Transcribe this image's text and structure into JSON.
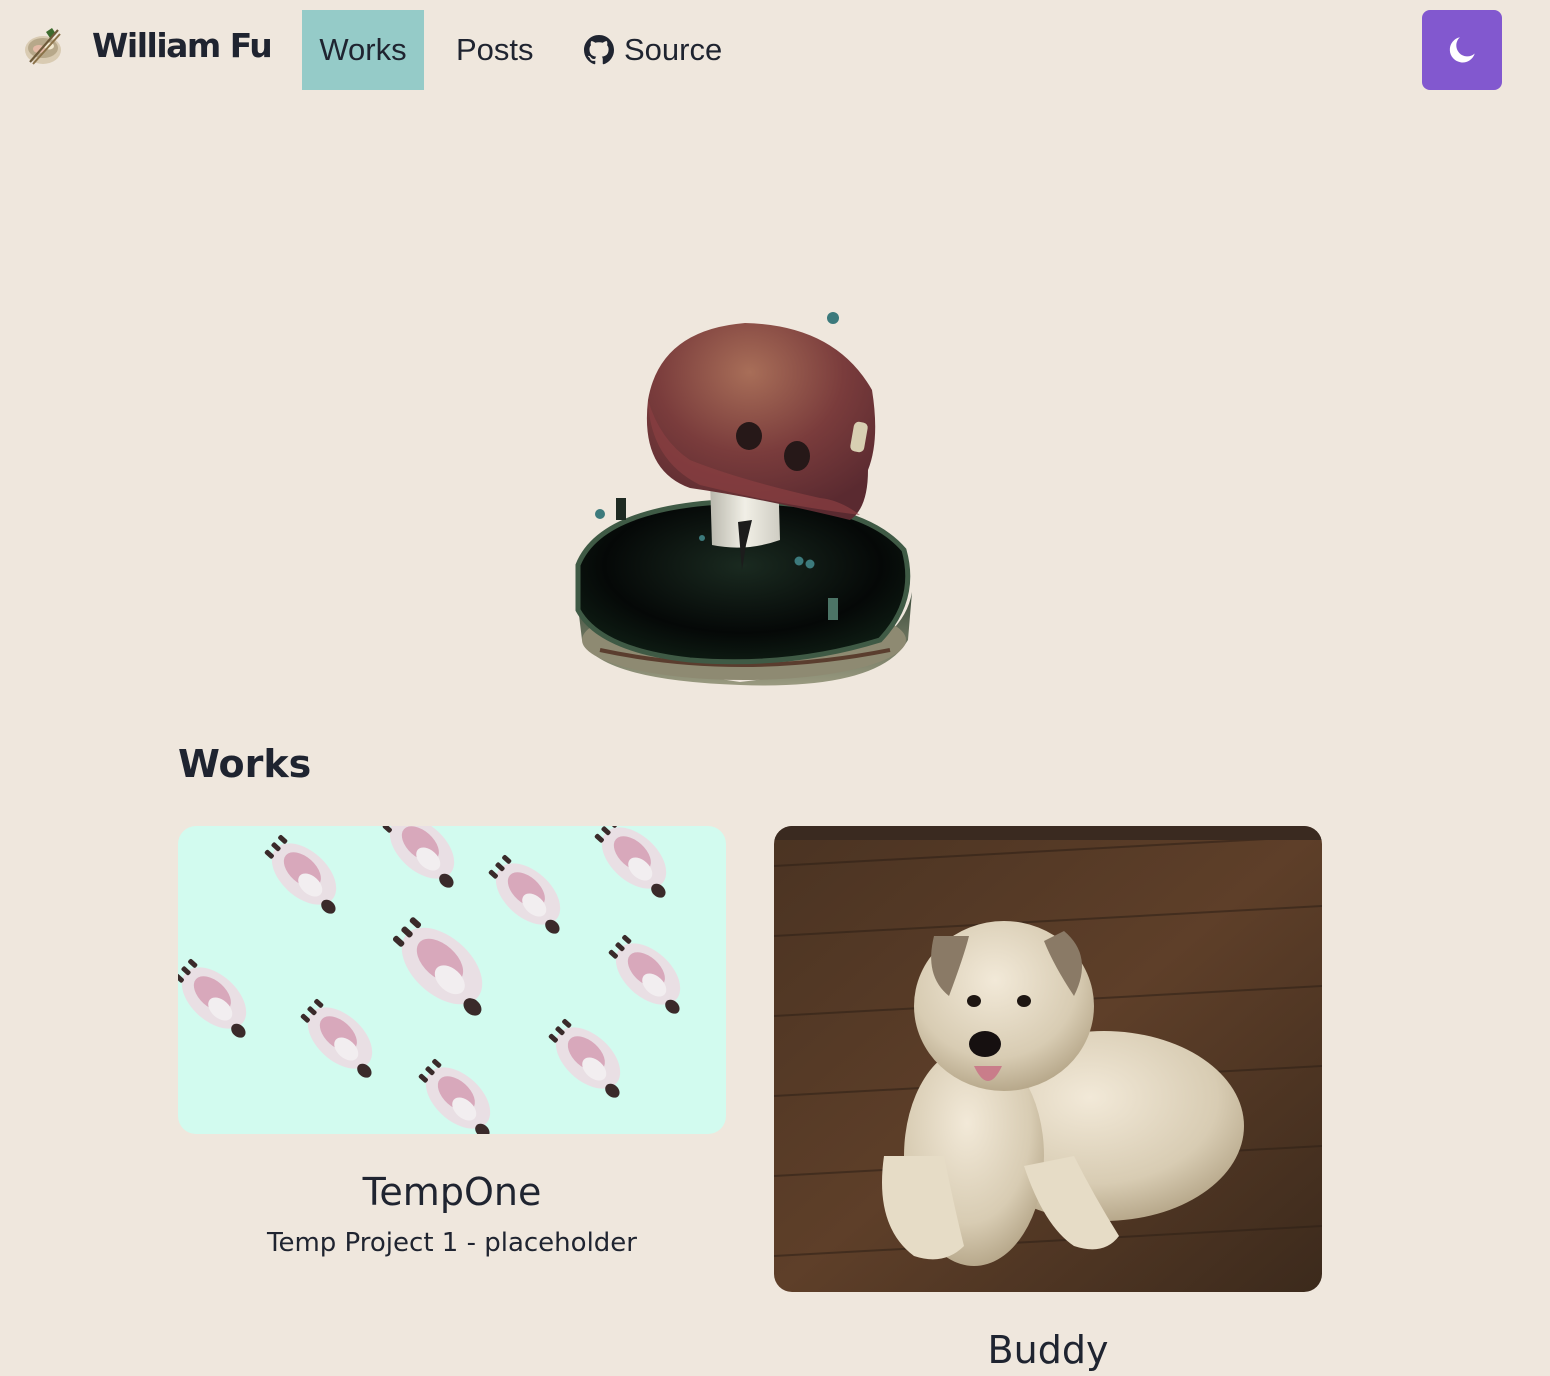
{
  "header": {
    "brand": "William Fu",
    "brand_icon": "ramen-bowl-icon",
    "nav": {
      "works": "Works",
      "posts": "Posts",
      "source": "Source",
      "source_icon": "github-icon",
      "active": "Works"
    },
    "theme_toggle_icon": "moon-icon",
    "colors": {
      "active_tab": "#95cbc8",
      "theme_button": "#8258cf",
      "background": "#efe7dd"
    }
  },
  "hero": {
    "model": "mushroom-in-hole"
  },
  "works": {
    "title": "Works",
    "items": [
      {
        "title": "TempOne",
        "description": "Temp Project 1 - placeholder",
        "thumbnail": "dog-pattern-thumbnail"
      },
      {
        "title": "Buddy",
        "description": "",
        "thumbnail": "dog-photo-thumbnail"
      }
    ]
  }
}
